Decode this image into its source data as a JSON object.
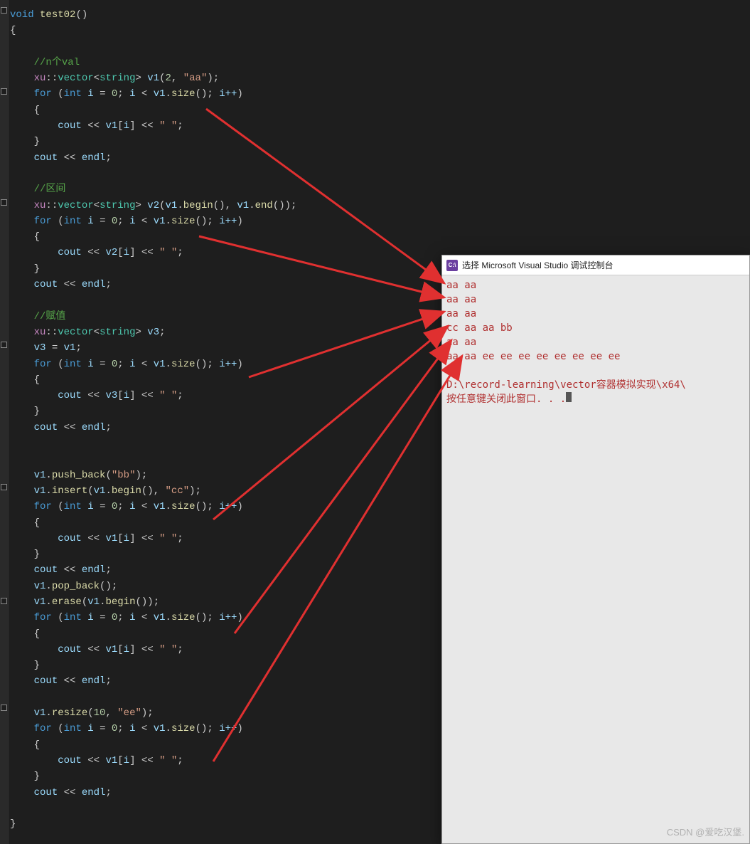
{
  "code": {
    "fn_sig": {
      "void": "void",
      "name": "test02",
      "parens": "()"
    },
    "open_brace": "{",
    "c1": "//n个val",
    "l2": {
      "ns": "xu",
      "sep": "::",
      "type": "vector",
      "lt": "<",
      "inner": "string",
      "gt": ">",
      "var": "v1",
      "args_open": "(",
      "n": "2",
      "comma": ", ",
      "s": "\"aa\"",
      "args_close": ");"
    },
    "for1": {
      "kw": "for",
      "open": " (",
      "int": "int",
      "var": "i",
      "eq": " = ",
      "zero": "0",
      "semi1": "; ",
      "cond_var": "i",
      "lt": " < ",
      "obj": "v1",
      "dot": ".",
      "fn": "size",
      "call": "()",
      "semi2": "; ",
      "inc": "i++",
      "close": ")"
    },
    "open_b": "{",
    "body1": {
      "cout": "cout",
      "ls": " << ",
      "arr": "v1",
      "lb": "[",
      "idx": "i",
      "rb": "]",
      "ls2": " << ",
      "sp": "\" \"",
      "end": ";"
    },
    "close_b": "}",
    "coutend": {
      "cout": "cout",
      "ls": " << ",
      "endl": "endl",
      "end": ";"
    },
    "c2": "//区间",
    "l_v2": {
      "ns": "xu",
      "sep": "::",
      "type": "vector",
      "lt": "<",
      "inner": "string",
      "gt": ">",
      "var": "v2",
      "args_open": "(",
      "a1o": "v1",
      "a1d": ".",
      "a1f": "begin",
      "a1c": "()",
      "comma": ", ",
      "a2o": "v1",
      "a2d": ".",
      "a2f": "end",
      "a2c": "()",
      "args_close": ");"
    },
    "body2": {
      "cout": "cout",
      "ls": " << ",
      "arr": "v2",
      "lb": "[",
      "idx": "i",
      "rb": "]",
      "ls2": " << ",
      "sp": "\" \"",
      "end": ";"
    },
    "c3": "//赋值",
    "l_v3": {
      "ns": "xu",
      "sep": "::",
      "type": "vector",
      "lt": "<",
      "inner": "string",
      "gt": ">",
      "var": "v3",
      "end": ";"
    },
    "assign": {
      "lhs": "v3",
      "eq": " = ",
      "rhs": "v1",
      "end": ";"
    },
    "body3": {
      "cout": "cout",
      "ls": " << ",
      "arr": "v3",
      "lb": "[",
      "idx": "i",
      "rb": "]",
      "ls2": " << ",
      "sp": "\" \"",
      "end": ";"
    },
    "push": {
      "obj": "v1",
      "dot": ".",
      "fn": "push_back",
      "open": "(",
      "arg": "\"bb\"",
      "close": ");"
    },
    "insert": {
      "obj": "v1",
      "dot": ".",
      "fn": "insert",
      "open": "(",
      "a1o": "v1",
      "a1d": ".",
      "a1f": "begin",
      "a1c": "()",
      "comma": ", ",
      "arg2": "\"cc\"",
      "close": ");"
    },
    "pop": {
      "obj": "v1",
      "dot": ".",
      "fn": "pop_back",
      "open": "(",
      "close": ");"
    },
    "erase": {
      "obj": "v1",
      "dot": ".",
      "fn": "erase",
      "open": "(",
      "a1o": "v1",
      "a1d": ".",
      "a1f": "begin",
      "a1c": "()",
      "close": ");"
    },
    "resize": {
      "obj": "v1",
      "dot": ".",
      "fn": "resize",
      "open": "(",
      "n": "10",
      "comma": ", ",
      "arg2": "\"ee\"",
      "close": ");"
    },
    "close_brace": "}"
  },
  "console": {
    "icon_text": "C:\\",
    "title": "选择 Microsoft Visual Studio 调试控制台",
    "lines": [
      "aa aa",
      "aa aa",
      "aa aa",
      "cc aa aa bb",
      "aa aa",
      "aa aa ee ee ee ee ee ee ee ee",
      "",
      "D:\\record-learning\\vector容器模拟实现\\x64\\",
      "按任意键关闭此窗口. . ."
    ]
  },
  "watermark": "CSDN @爱吃汉堡."
}
